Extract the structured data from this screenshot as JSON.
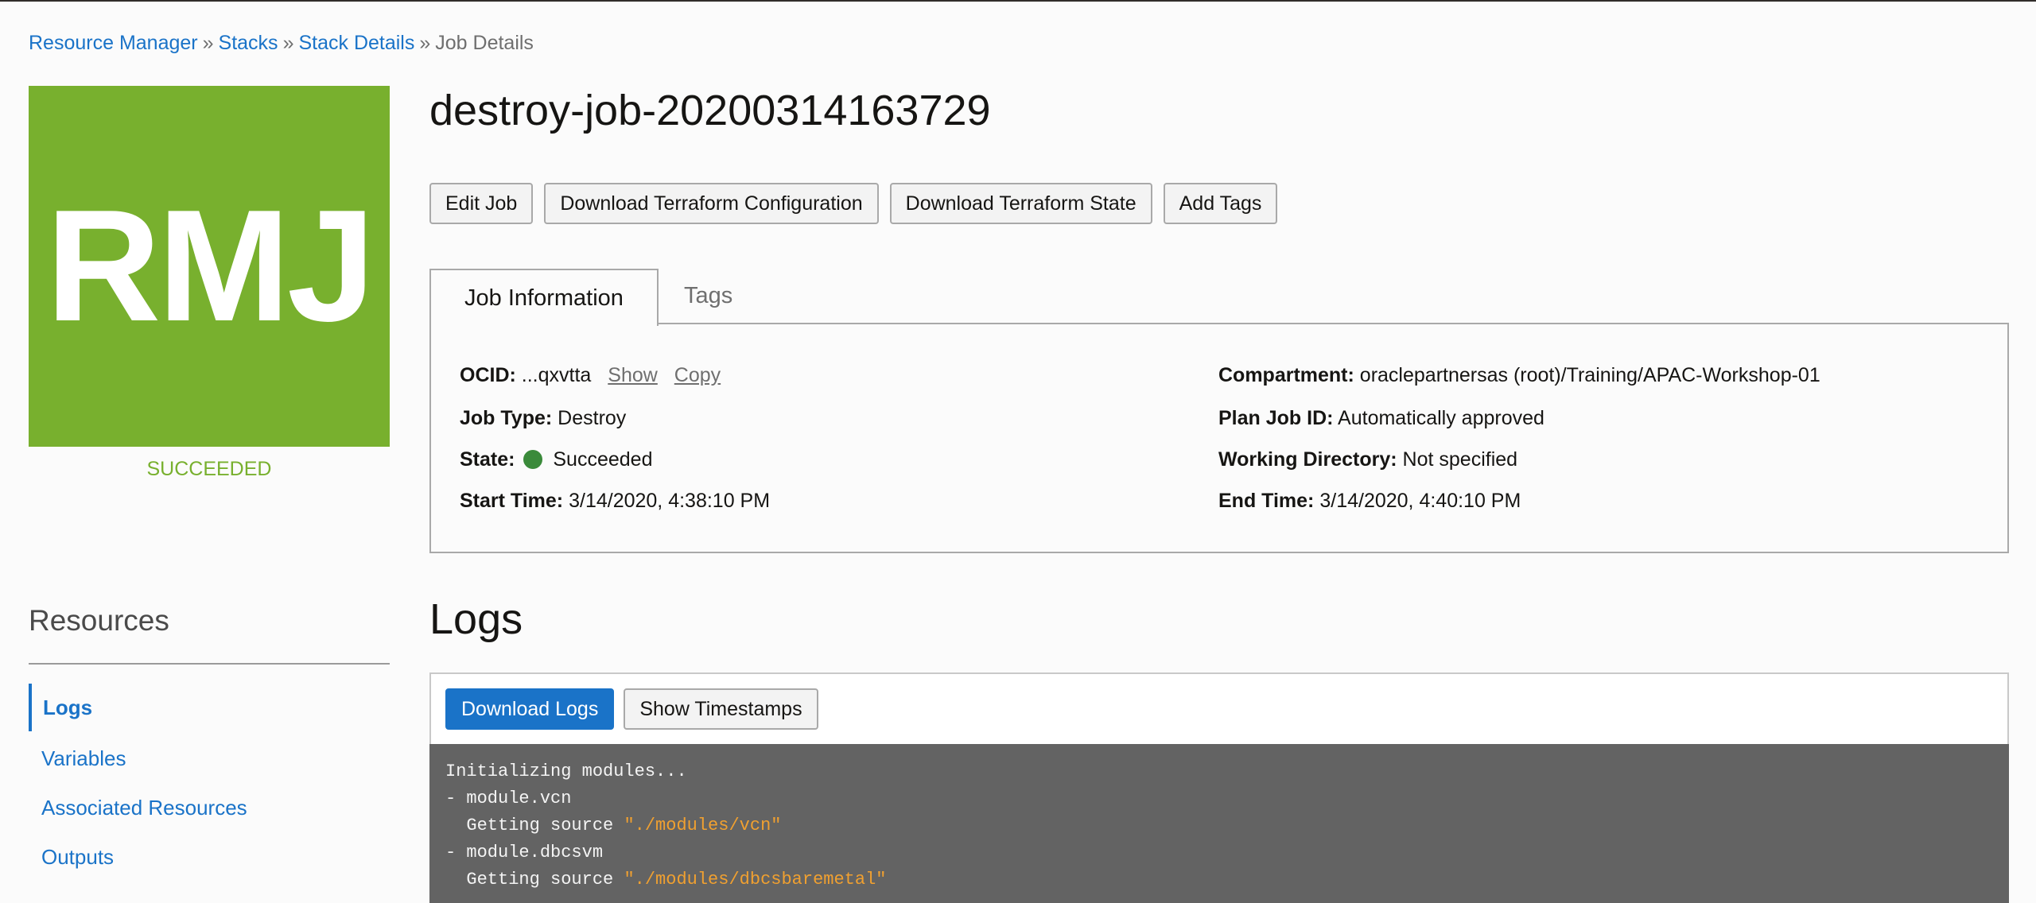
{
  "breadcrumb": {
    "items": [
      "Resource Manager",
      "Stacks",
      "Stack Details"
    ],
    "separator": "»",
    "current": "Job Details"
  },
  "logo": {
    "text": "RMJ",
    "color": "#78b02e"
  },
  "status": {
    "text": "SUCCEEDED",
    "color": "#78b02e"
  },
  "job": {
    "title": "destroy-job-20200314163729"
  },
  "toolbar": {
    "edit_label": "Edit Job",
    "download_config_label": "Download Terraform Configuration",
    "download_state_label": "Download Terraform State",
    "add_tags_label": "Add Tags"
  },
  "tabs": {
    "items": [
      {
        "label": "Job Information"
      },
      {
        "label": "Tags"
      }
    ]
  },
  "info": {
    "ocid": {
      "label": "OCID:",
      "value": "...qxvtta",
      "show": "Show",
      "copy": "Copy"
    },
    "job_type": {
      "label": "Job Type:",
      "value": "Destroy"
    },
    "state": {
      "label": "State:",
      "value": "Succeeded",
      "color": "#3a8a3a"
    },
    "start_time": {
      "label": "Start Time:",
      "value": "3/14/2020, 4:38:10 PM"
    },
    "compartment": {
      "label": "Compartment:",
      "value": "oraclepartnersas (root)/Training/APAC-Workshop-01"
    },
    "plan_job_id": {
      "label": "Plan Job ID:",
      "value": "Automatically approved"
    },
    "working_directory": {
      "label": "Working Directory:",
      "value": "Not specified"
    },
    "end_time": {
      "label": "End Time:",
      "value": "3/14/2020, 4:40:10 PM"
    }
  },
  "resources": {
    "title": "Resources",
    "items": [
      {
        "label": "Logs"
      },
      {
        "label": "Variables"
      },
      {
        "label": "Associated Resources"
      },
      {
        "label": "Outputs"
      }
    ]
  },
  "logs": {
    "title": "Logs",
    "download_label": "Download Logs",
    "timestamps_label": "Show Timestamps",
    "lines": [
      {
        "text": "Initializing modules...",
        "str": ""
      },
      {
        "text": "- module.vcn",
        "str": ""
      },
      {
        "text": "  Getting source ",
        "str": "\"./modules/vcn\""
      },
      {
        "text": "- module.dbcsvm",
        "str": ""
      },
      {
        "text": "  Getting source ",
        "str": "\"./modules/dbcsbaremetal\""
      }
    ]
  },
  "colors": {
    "accent": "#1a73c8",
    "console_bg": "#636363",
    "string": "#f0a030"
  }
}
